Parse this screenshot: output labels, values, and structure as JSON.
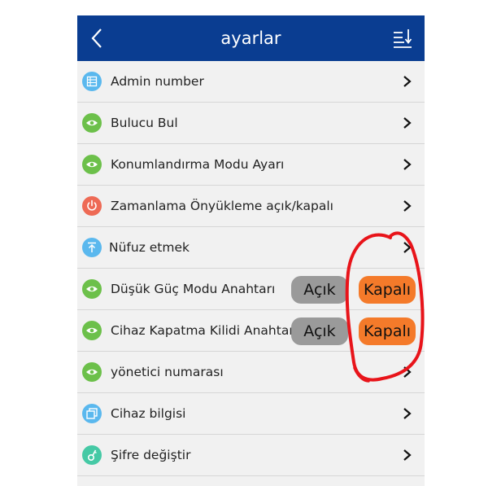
{
  "header": {
    "title": "ayarlar",
    "back_icon": "chevron-left-icon",
    "sort_icon": "sort-down-icon",
    "background": "#0a3d91"
  },
  "settings": [
    {
      "label": "Admin number",
      "icon": "list-icon",
      "icon_color": "#5ab8ee",
      "chevron": ">"
    },
    {
      "label": "Bulucu Bul",
      "icon": "eye-icon",
      "icon_color": "#6cc04a",
      "chevron": ">"
    },
    {
      "label": "Konumlandırma Modu Ayarı",
      "icon": "eye-icon",
      "icon_color": "#6cc04a",
      "chevron": ">"
    },
    {
      "label": "Zamanlama Önyükleme açık/kapalı",
      "icon": "power-icon",
      "icon_color": "#ee6a55",
      "chevron": ">"
    },
    {
      "label": "Nüfuz etmek",
      "icon": "upload-icon",
      "icon_color": "#5ab8ee",
      "chevron": ">"
    },
    {
      "label": "Düşük Güç Modu Anahtarı",
      "icon": "eye-icon",
      "icon_color": "#6cc04a",
      "on_label": "Açık",
      "off_label": "Kapalı"
    },
    {
      "label": "Cihaz Kapatma Kilidi Anahtarı",
      "icon": "eye-icon",
      "icon_color": "#6cc04a",
      "on_label": "Açık",
      "off_label": "Kapalı"
    },
    {
      "label": "yönetici numarası",
      "icon": "eye-icon",
      "icon_color": "#6cc04a",
      "chevron": ">"
    },
    {
      "label": "Cihaz bilgisi",
      "icon": "copy-icon",
      "icon_color": "#5ab8ee",
      "chevron": ">"
    },
    {
      "label": "Şifre değiştir",
      "icon": "key-icon",
      "icon_color": "#45c9a5",
      "chevron": ">"
    }
  ],
  "colors": {
    "open_button": "#9a9a9a",
    "closed_button": "#f47a2a",
    "annotation": "#e8141a"
  }
}
